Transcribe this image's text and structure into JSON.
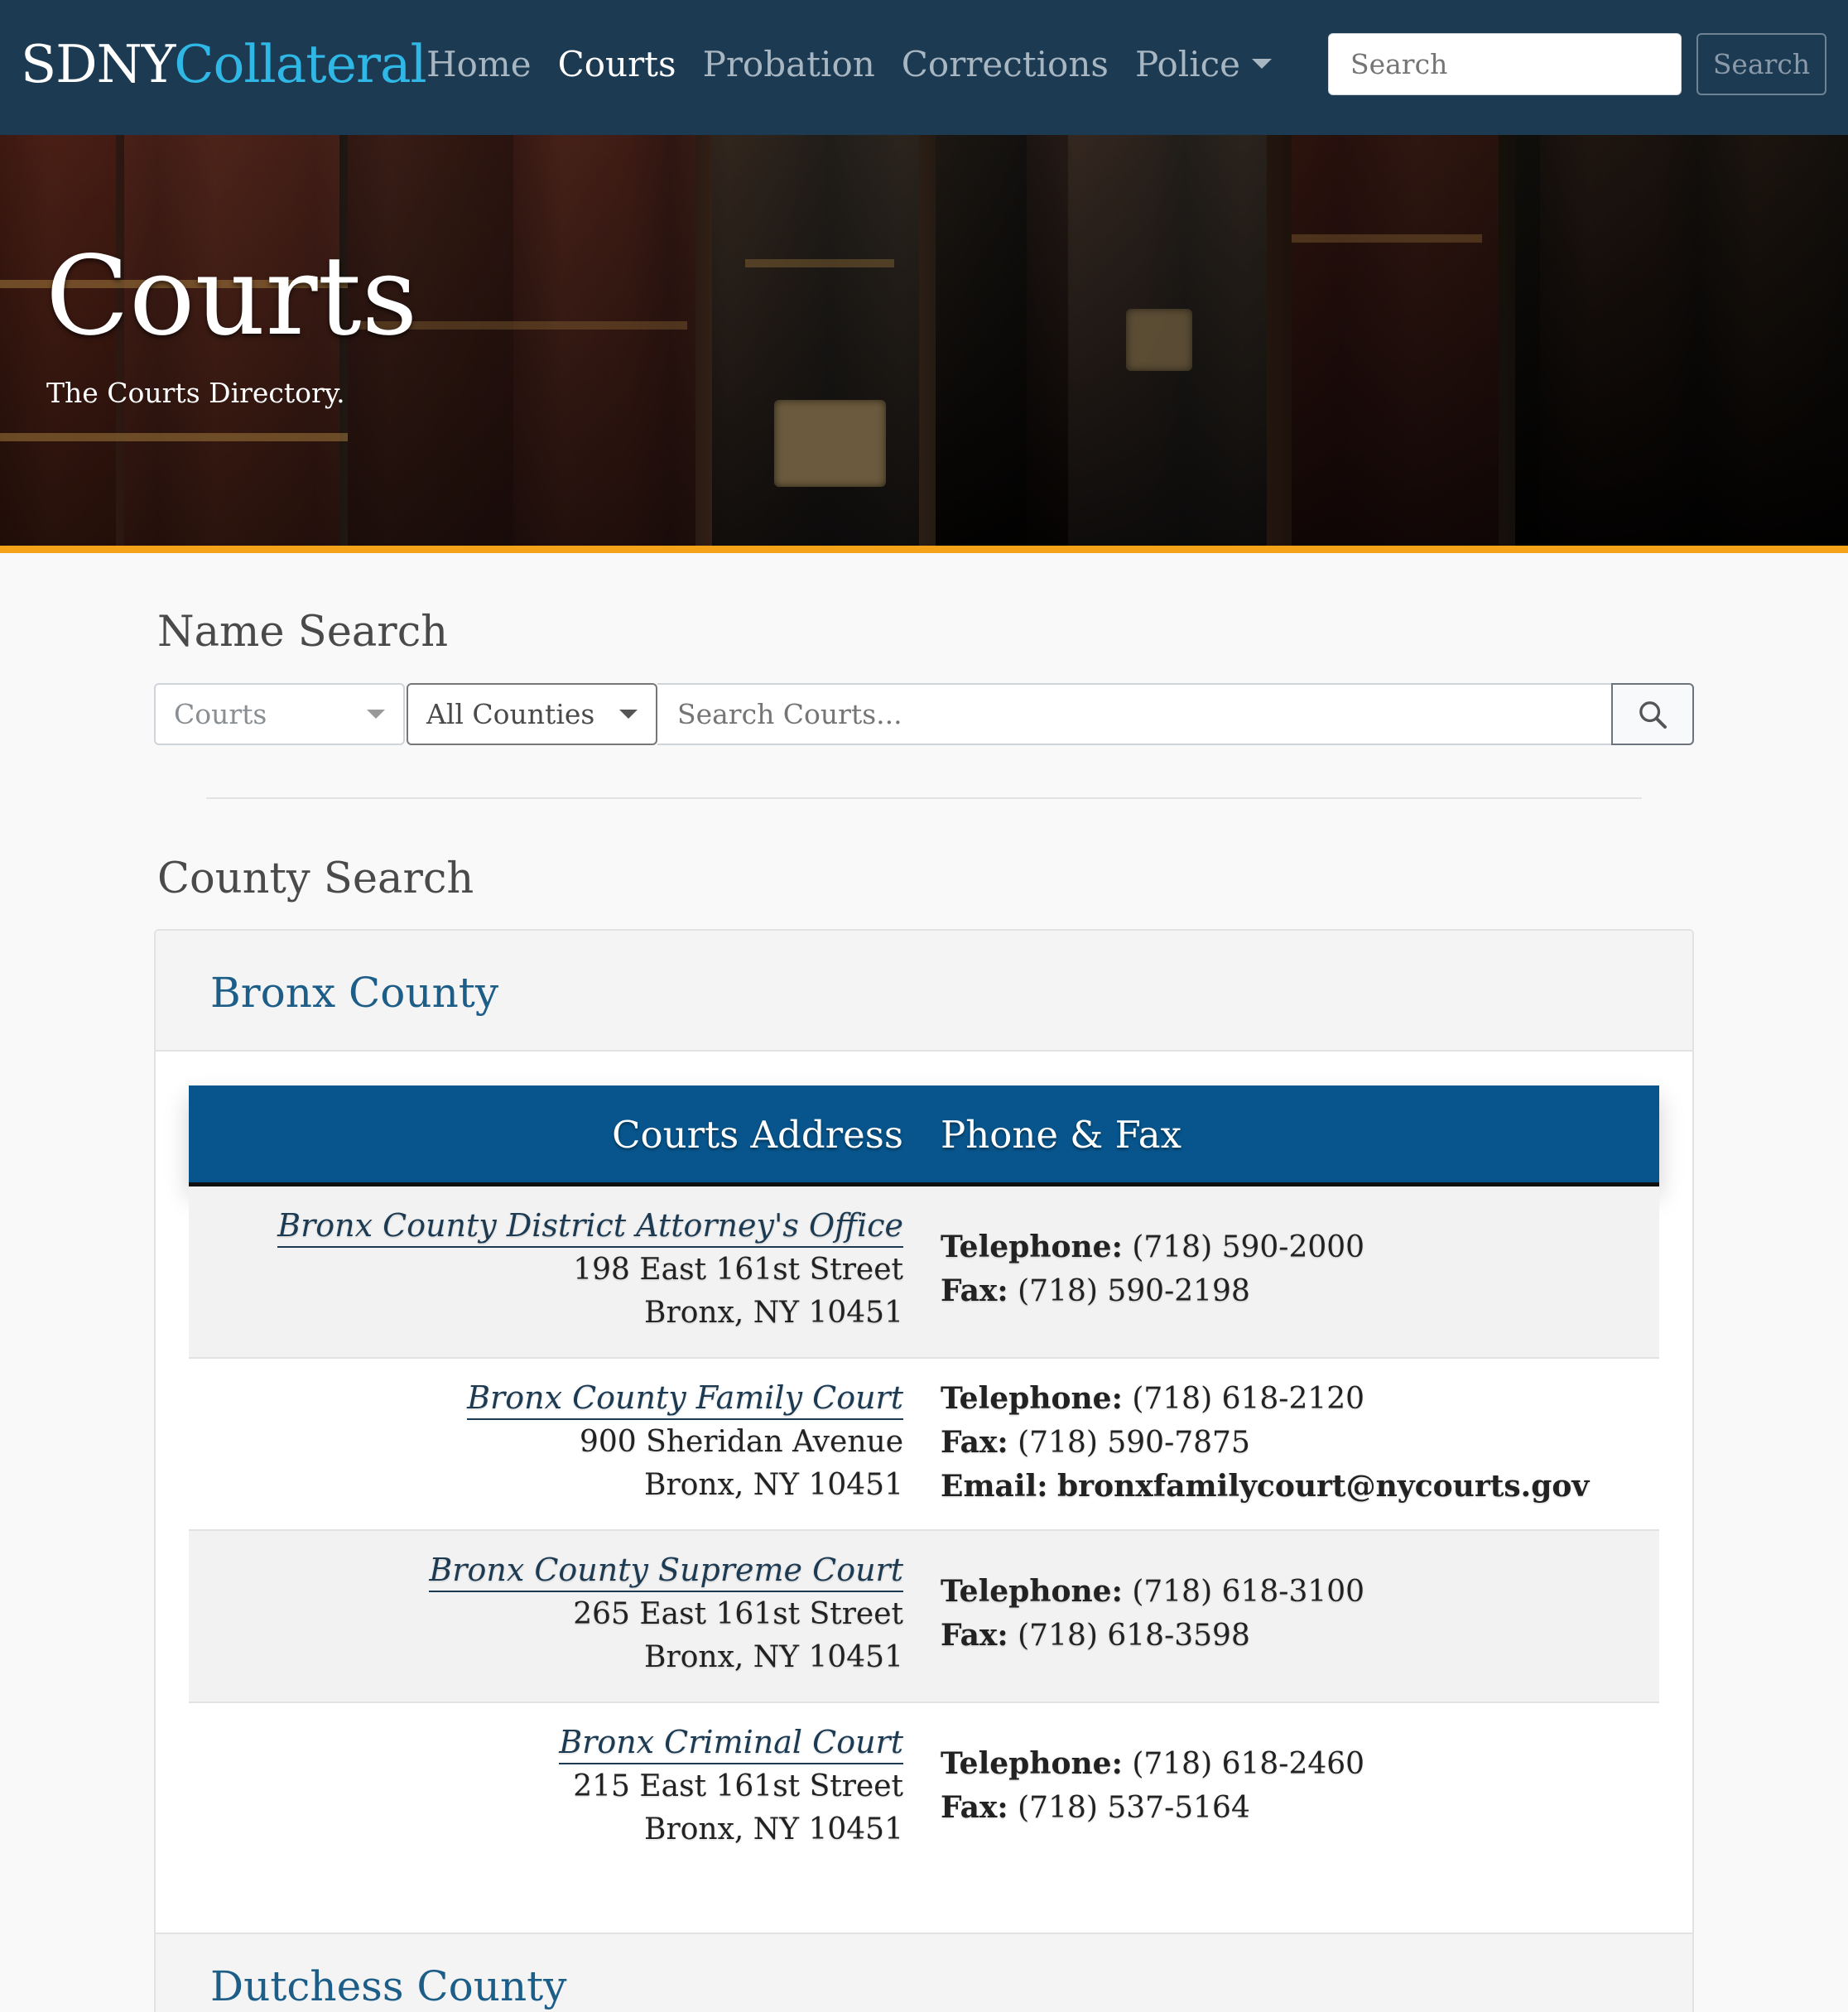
{
  "nav": {
    "brand_part1": "SDNY",
    "brand_part2": "Collateral",
    "links": [
      "Home",
      "Courts",
      "Probation",
      "Corrections",
      "Police"
    ],
    "active": "Courts",
    "search_placeholder": "Search",
    "search_button": "Search"
  },
  "hero": {
    "title": "Courts",
    "subtitle": "The Courts Directory."
  },
  "name_search": {
    "title": "Name Search",
    "type_select": "Courts",
    "county_select": "All Counties",
    "input_placeholder": "Search Courts..."
  },
  "county_search": {
    "title": "County Search",
    "counties": [
      {
        "name": "Bronx County",
        "table_headers": {
          "address": "Courts Address",
          "phone": "Phone & Fax"
        },
        "courts": [
          {
            "name": "Bronx County District Attorney's Office",
            "street": "198 East 161st Street",
            "city": "Bronx, NY 10451",
            "telephone": "(718) 590-2000",
            "fax": "(718) 590-2198"
          },
          {
            "name": "Bronx County Family Court",
            "street": "900 Sheridan Avenue",
            "city": "Bronx, NY 10451",
            "telephone": "(718) 618-2120",
            "fax": "(718) 590-7875",
            "email": "bronxfamilycourt@nycourts.gov"
          },
          {
            "name": "Bronx County Supreme Court",
            "street": "265 East 161st Street",
            "city": "Bronx, NY 10451",
            "telephone": "(718) 618-3100",
            "fax": "(718) 618-3598"
          },
          {
            "name": "Bronx Criminal Court",
            "street": "215 East 161st Street",
            "city": "Bronx, NY 10451",
            "telephone": "(718) 618-2460",
            "fax": "(718) 537-5164"
          }
        ]
      },
      {
        "name": "Dutchess County"
      }
    ],
    "labels": {
      "telephone": "Telephone:",
      "fax": "Fax:",
      "email": "Email:"
    }
  },
  "colors": {
    "navbar": "#1c3a52",
    "brand_accent": "#2fb8e6",
    "hero_bar": "#f5a419",
    "table_header": "#07558c",
    "county_link": "#1d5e88"
  },
  "icons": [
    "chevron-down-icon",
    "search-icon"
  ]
}
